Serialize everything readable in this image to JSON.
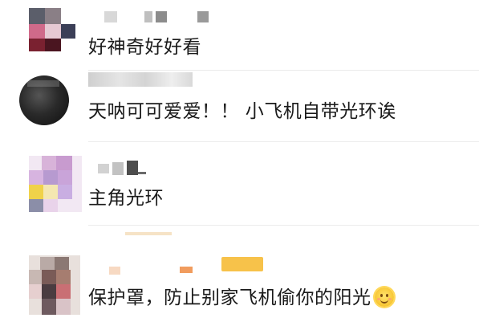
{
  "comments": [
    {
      "text": "好神奇好好看",
      "emoji": null
    },
    {
      "text": "天呐可可爱爱！！ 小飞机自带光环诶",
      "emoji": null
    },
    {
      "text": "主角光环",
      "emoji": null
    },
    {
      "text": "保护罩，防止别家飞机偷你的阳光",
      "emoji": "smile-emoji"
    }
  ]
}
